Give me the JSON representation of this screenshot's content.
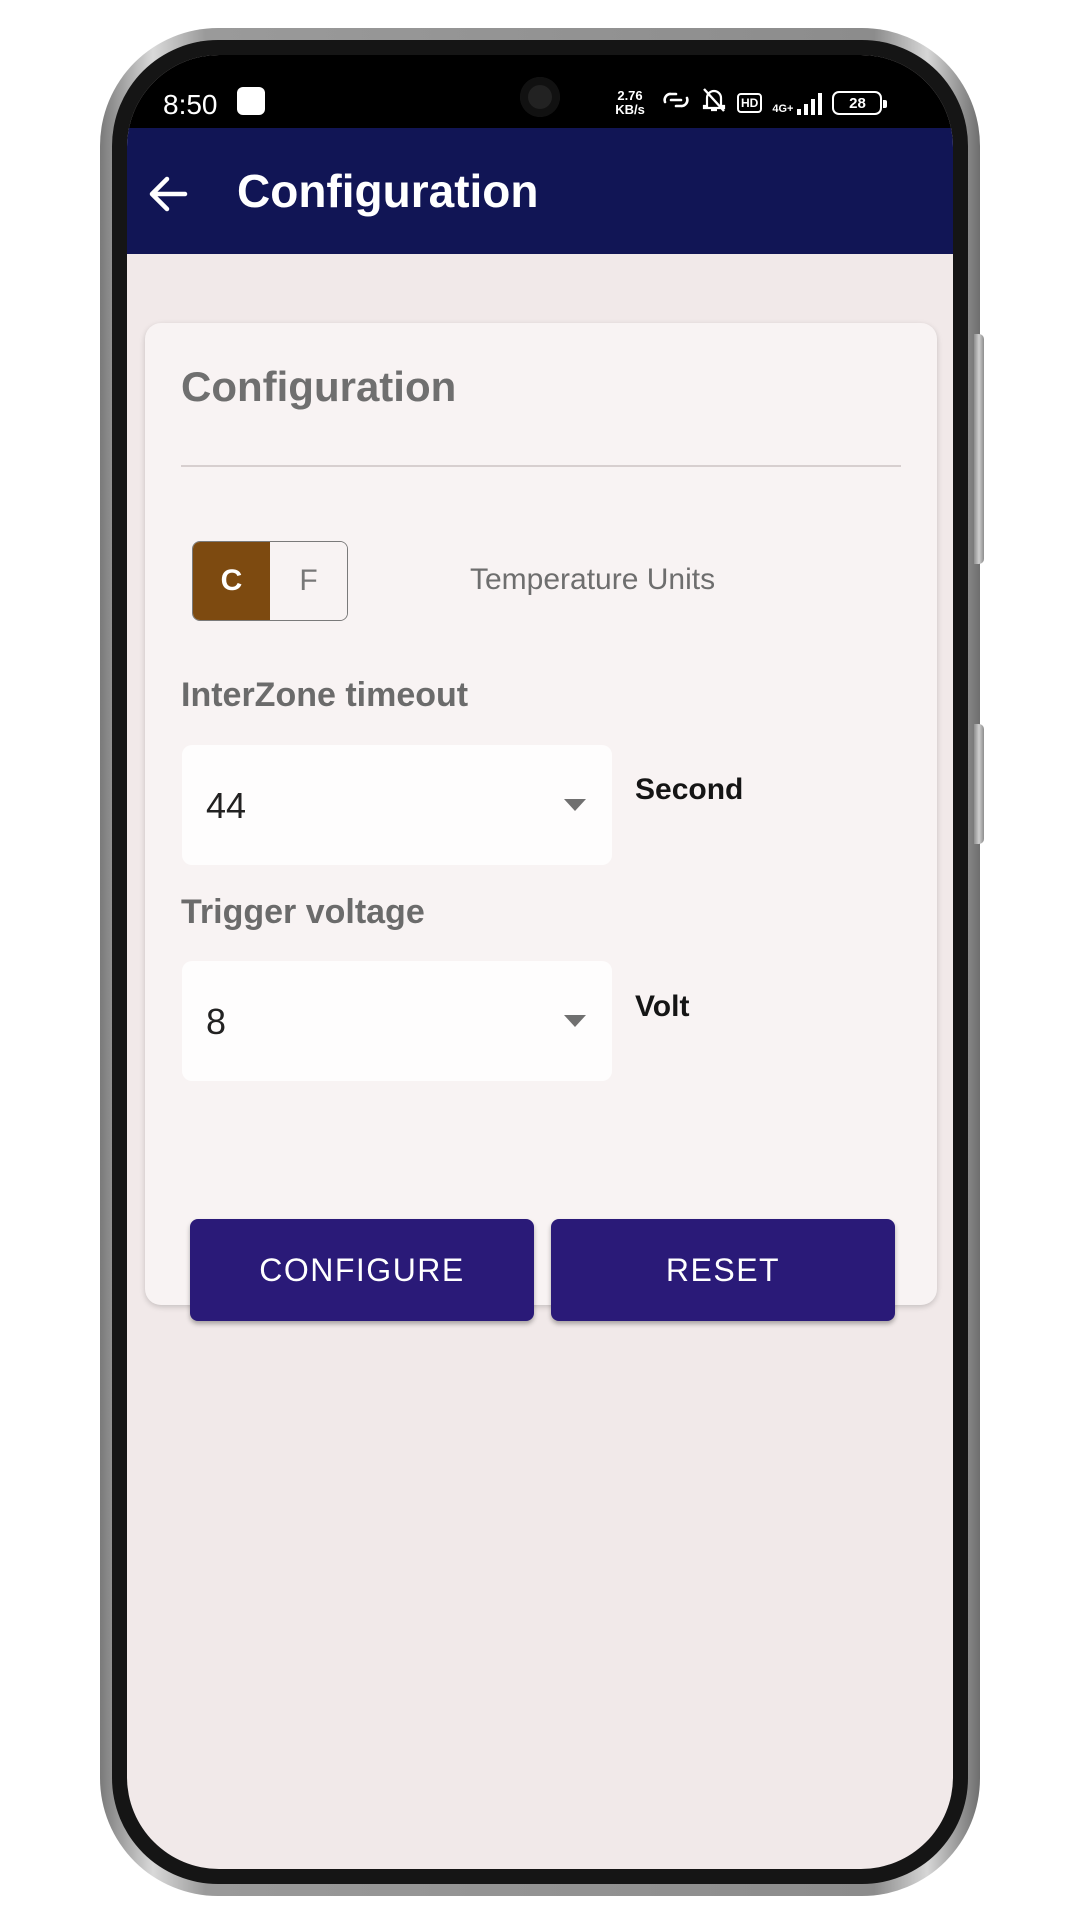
{
  "status_bar": {
    "time": "8:50",
    "network_speed_value": "2.76",
    "network_speed_unit": "KB/s",
    "hd_badge": "HD",
    "network_type": "4G+",
    "battery_level": "28"
  },
  "app_bar": {
    "title": "Configuration"
  },
  "card": {
    "title": "Configuration",
    "temperature": {
      "label": "Temperature Units",
      "options": [
        "C",
        "F"
      ],
      "selected": "C"
    },
    "interzone": {
      "label": "InterZone timeout",
      "value": "44",
      "unit": "Second"
    },
    "trigger": {
      "label": "Trigger voltage",
      "value": "8",
      "unit": "Volt"
    },
    "buttons": {
      "configure": "CONFIGURE",
      "reset": "RESET"
    }
  },
  "colors": {
    "app_bar": "#111555",
    "button": "#2a1a78",
    "toggle_active": "#7d4a10",
    "background": "#f1e9e9"
  }
}
